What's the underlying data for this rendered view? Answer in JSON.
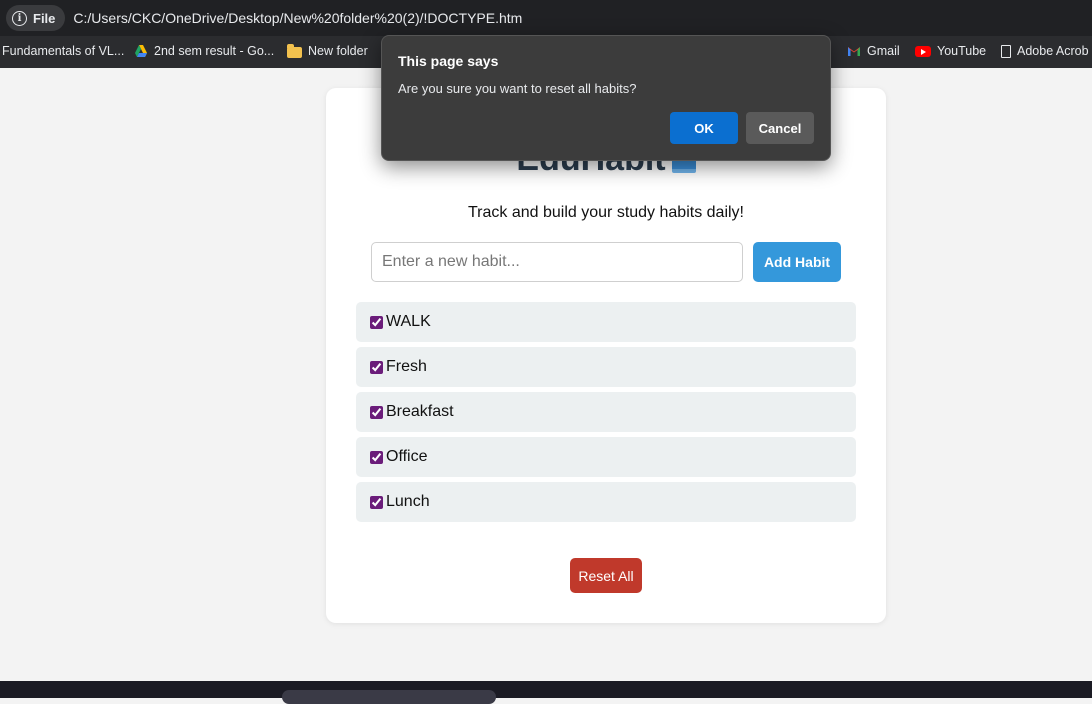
{
  "browser": {
    "site_info_label": "File",
    "url": "C:/Users/CKC/OneDrive/Desktop/New%20folder%20(2)/!DOCTYPE.htm"
  },
  "bookmarks": [
    {
      "label": "Fundamentals of VL...",
      "icon": "none"
    },
    {
      "label": "2nd sem result - Go...",
      "icon": "google-drive-icon"
    },
    {
      "label": "New folder",
      "icon": "folder-icon"
    },
    {
      "label": "Gmail",
      "icon": "gmail-icon"
    },
    {
      "label": "YouTube",
      "icon": "youtube-icon"
    },
    {
      "label": "Adobe Acrob",
      "icon": "document-icon"
    }
  ],
  "app": {
    "title": "EduHabit",
    "subtitle": "Track and build your study habits daily!",
    "input_placeholder": "Enter a new habit...",
    "add_button": "Add Habit",
    "habits": [
      {
        "label": "WALK",
        "checked": true
      },
      {
        "label": "Fresh",
        "checked": true
      },
      {
        "label": "Breakfast",
        "checked": true
      },
      {
        "label": "Office",
        "checked": true
      },
      {
        "label": "Lunch",
        "checked": true
      }
    ],
    "reset_button": "Reset All"
  },
  "dialog": {
    "title": "This page says",
    "message": "Are you sure you want to reset all habits?",
    "ok_label": "OK",
    "cancel_label": "Cancel"
  },
  "colors": {
    "primary": "#3498db",
    "danger": "#c0392b",
    "title": "#2c3e50",
    "dialog_ok": "#0b6fd0"
  }
}
